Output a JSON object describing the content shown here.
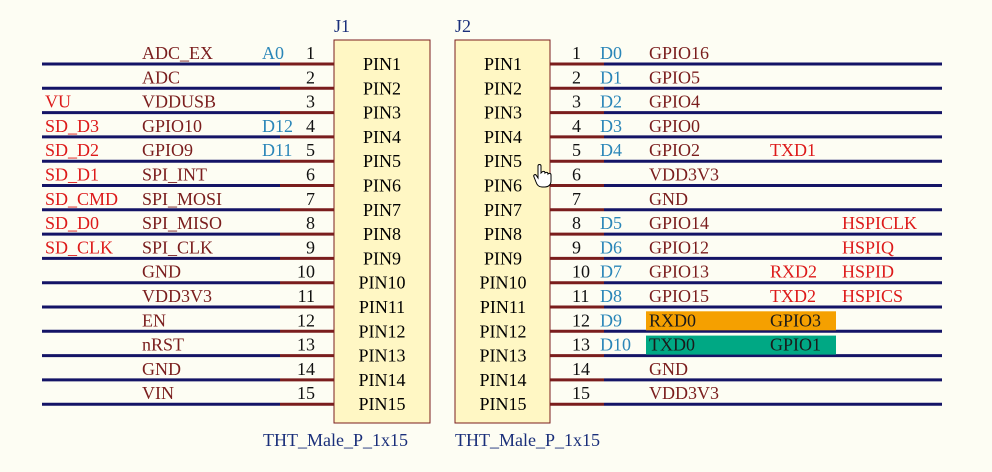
{
  "colors": {
    "background": "#fdfdf3",
    "wire": "#141466",
    "pin_stub": "#7a1d1d",
    "net_label": "#7a1d1d",
    "pin_number": "#111111",
    "alias_blue": "#2a86b8",
    "alias_red": "#dd1a1a",
    "component_fill": "#fff7c4",
    "component_stroke": "#7a1d1d",
    "component_text": "#000000",
    "designator": "#1a2f7a",
    "highlight_orange": "#f5a000",
    "highlight_green": "#00a884"
  },
  "j1": {
    "designator": "J1",
    "footprint": "THT_Male_P_1x15",
    "pins": [
      {
        "pin_label": "PIN1",
        "number": "1",
        "net": "ADC_EX",
        "gpio": "A0",
        "alias": ""
      },
      {
        "pin_label": "PIN2",
        "number": "2",
        "net": "ADC",
        "gpio": "",
        "alias": ""
      },
      {
        "pin_label": "PIN3",
        "number": "3",
        "net": "VDDUSB",
        "gpio": "",
        "alias": "VU"
      },
      {
        "pin_label": "PIN4",
        "number": "4",
        "net": "GPIO10",
        "gpio": "D12",
        "alias": "SD_D3"
      },
      {
        "pin_label": "PIN5",
        "number": "5",
        "net": "GPIO9",
        "gpio": "D11",
        "alias": "SD_D2"
      },
      {
        "pin_label": "PIN6",
        "number": "6",
        "net": "SPI_INT",
        "gpio": "",
        "alias": "SD_D1"
      },
      {
        "pin_label": "PIN7",
        "number": "7",
        "net": "SPI_MOSI",
        "gpio": "",
        "alias": "SD_CMD"
      },
      {
        "pin_label": "PIN8",
        "number": "8",
        "net": "SPI_MISO",
        "gpio": "",
        "alias": "SD_D0"
      },
      {
        "pin_label": "PIN9",
        "number": "9",
        "net": "SPI_CLK",
        "gpio": "",
        "alias": "SD_CLK"
      },
      {
        "pin_label": "PIN10",
        "number": "10",
        "net": "GND",
        "gpio": "",
        "alias": ""
      },
      {
        "pin_label": "PIN11",
        "number": "11",
        "net": "VDD3V3",
        "gpio": "",
        "alias": ""
      },
      {
        "pin_label": "PIN12",
        "number": "12",
        "net": "EN",
        "gpio": "",
        "alias": ""
      },
      {
        "pin_label": "PIN13",
        "number": "13",
        "net": "nRST",
        "gpio": "",
        "alias": ""
      },
      {
        "pin_label": "PIN14",
        "number": "14",
        "net": "GND",
        "gpio": "",
        "alias": ""
      },
      {
        "pin_label": "PIN15",
        "number": "15",
        "net": "VIN",
        "gpio": "",
        "alias": ""
      }
    ]
  },
  "j2": {
    "designator": "J2",
    "footprint": "THT_Male_P_1x15",
    "pins": [
      {
        "pin_label": "PIN1",
        "number": "1",
        "gpio": "D0",
        "net": "GPIO16",
        "func1": "",
        "func2": "",
        "highlight": ""
      },
      {
        "pin_label": "PIN2",
        "number": "2",
        "gpio": "D1",
        "net": "GPIO5",
        "func1": "",
        "func2": "",
        "highlight": ""
      },
      {
        "pin_label": "PIN3",
        "number": "3",
        "gpio": "D2",
        "net": "GPIO4",
        "func1": "",
        "func2": "",
        "highlight": ""
      },
      {
        "pin_label": "PIN4",
        "number": "4",
        "gpio": "D3",
        "net": "GPIO0",
        "func1": "",
        "func2": "",
        "highlight": ""
      },
      {
        "pin_label": "PIN5",
        "number": "5",
        "gpio": "D4",
        "net": "GPIO2",
        "func1": "TXD1",
        "func2": "",
        "highlight": ""
      },
      {
        "pin_label": "PIN6",
        "number": "6",
        "gpio": "",
        "net": "VDD3V3",
        "func1": "",
        "func2": "",
        "highlight": ""
      },
      {
        "pin_label": "PIN7",
        "number": "7",
        "gpio": "",
        "net": "GND",
        "func1": "",
        "func2": "",
        "highlight": ""
      },
      {
        "pin_label": "PIN8",
        "number": "8",
        "gpio": "D5",
        "net": "GPIO14",
        "func1": "",
        "func2": "HSPICLK",
        "highlight": ""
      },
      {
        "pin_label": "PIN9",
        "number": "9",
        "gpio": "D6",
        "net": "GPIO12",
        "func1": "",
        "func2": "HSPIQ",
        "highlight": ""
      },
      {
        "pin_label": "PIN10",
        "number": "10",
        "gpio": "D7",
        "net": "GPIO13",
        "func1": "RXD2",
        "func2": "HSPID",
        "highlight": ""
      },
      {
        "pin_label": "PIN11",
        "number": "11",
        "gpio": "D8",
        "net": "GPIO15",
        "func1": "TXD2",
        "func2": "HSPICS",
        "highlight": ""
      },
      {
        "pin_label": "PIN12",
        "number": "12",
        "gpio": "D9",
        "net": "RXD0",
        "func1": "GPIO3",
        "func2": "",
        "highlight": "orange"
      },
      {
        "pin_label": "PIN13",
        "number": "13",
        "gpio": "D10",
        "net": "TXD0",
        "func1": "GPIO1",
        "func2": "",
        "highlight": "green"
      },
      {
        "pin_label": "PIN14",
        "number": "14",
        "gpio": "",
        "net": "GND",
        "func1": "",
        "func2": "",
        "highlight": ""
      },
      {
        "pin_label": "PIN15",
        "number": "15",
        "gpio": "",
        "net": "VDD3V3",
        "func1": "",
        "func2": "",
        "highlight": ""
      }
    ]
  },
  "cursor_icon": "hand-pointer-icon"
}
